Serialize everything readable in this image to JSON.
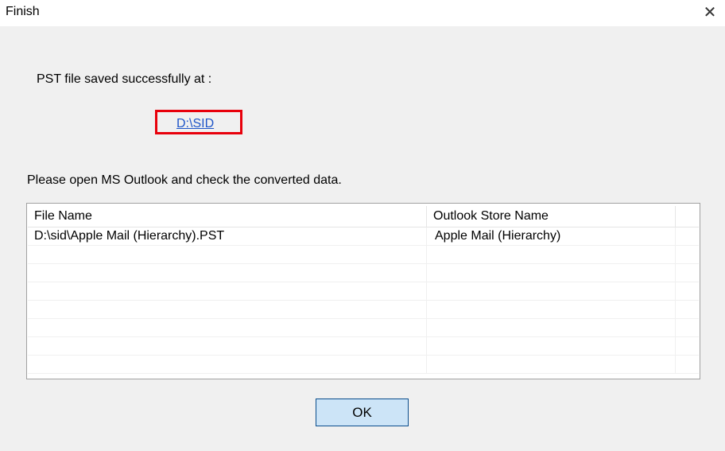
{
  "window": {
    "title": "Finish",
    "close_symbol": "✕"
  },
  "message": {
    "saved_label": "PST file saved successfully at :",
    "saved_path": "D:\\SID",
    "instruction": "Please open MS Outlook and check the converted data."
  },
  "table": {
    "columns": [
      "File Name",
      "Outlook Store Name",
      ""
    ],
    "rows": [
      [
        "D:\\sid\\Apple Mail (Hierarchy).PST",
        "Apple Mail (Hierarchy)",
        ""
      ],
      [
        "",
        "",
        ""
      ],
      [
        "",
        "",
        ""
      ],
      [
        "",
        "",
        ""
      ],
      [
        "",
        "",
        ""
      ],
      [
        "",
        "",
        ""
      ],
      [
        "",
        "",
        ""
      ],
      [
        "",
        "",
        ""
      ]
    ]
  },
  "buttons": {
    "ok_label": "OK"
  },
  "colors": {
    "highlight_border": "#e8000b",
    "link": "#1f55c8",
    "button_face": "#cce4f7",
    "button_border": "#0a4d8c"
  }
}
